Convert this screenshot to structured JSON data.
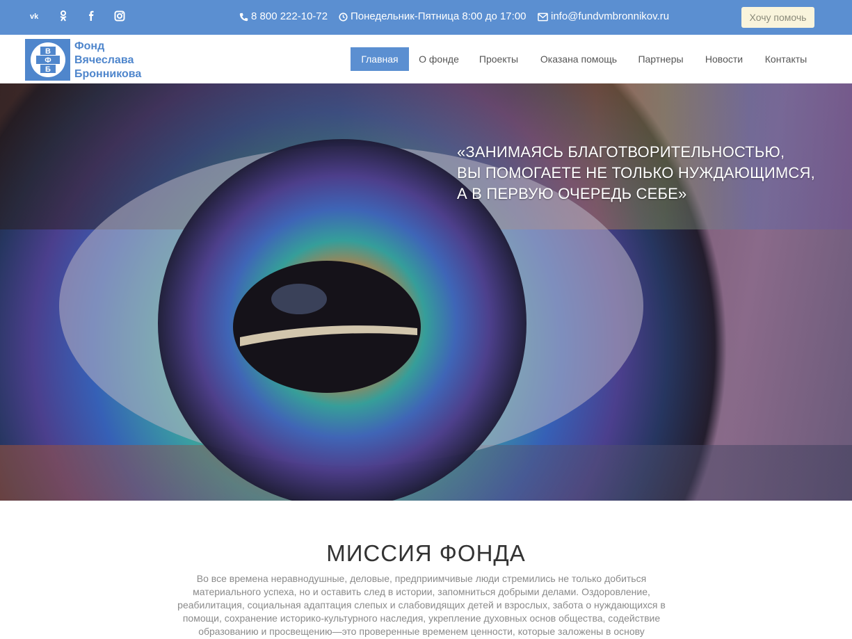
{
  "topbar": {
    "social": [
      "vk-icon",
      "odnoklassniki-icon",
      "facebook-icon",
      "instagram-icon"
    ],
    "phone": "8 800 222-10-72",
    "hours": "Понедельник-Пятница 8:00 до 17:00",
    "email": "info@fundvmbronnikov.ru",
    "help_button": "Хочу помочь"
  },
  "header": {
    "logo_lines": [
      "Фонд",
      "Вячеслава",
      "Бронникова"
    ],
    "nav": [
      {
        "label": "Главная",
        "active": true
      },
      {
        "label": "О фонде",
        "active": false
      },
      {
        "label": "Проекты",
        "active": false
      },
      {
        "label": "Оказана помощь",
        "active": false
      },
      {
        "label": "Партнеры",
        "active": false
      },
      {
        "label": "Новости",
        "active": false
      },
      {
        "label": "Контакты",
        "active": false
      }
    ]
  },
  "hero": {
    "quote_lines": [
      "«ЗАНИМАЯСЬ БЛАГОТВОРИТЕЛЬНОСТЬЮ,",
      "ВЫ ПОМОГАЕТЕ НЕ ТОЛЬКО НУЖДАЮЩИМСЯ,",
      "А В ПЕРВУЮ ОЧЕРЕДЬ СЕБЕ»"
    ]
  },
  "mission": {
    "title": "МИССИЯ ФОНДА",
    "text": "Во все времена неравнодушные, деловые, предприимчивые люди стремились не только добиться материального успеха, но и оставить след в истории, запомниться добрыми делами. Оздоровление, реабилитация, социальная адаптация слепых и слабовидящих детей и взрослых, забота о нуждающихся в помощи, сохранение историко-культурного наследия, укрепление духовных основ общества, содействие образованию и просвещению—это проверенные временем ценности, которые заложены в основу"
  },
  "colors": {
    "brand_blue": "#5b8fd1",
    "help_button_bg": "#f9f4dc"
  }
}
